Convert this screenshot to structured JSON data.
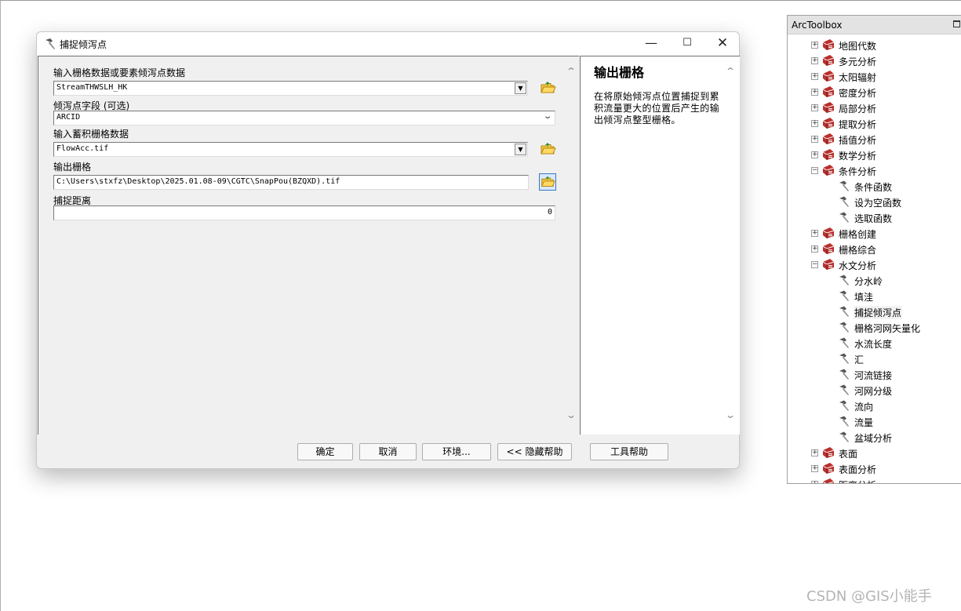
{
  "dialog": {
    "title": "捕捉倾泻点",
    "params": {
      "input_raster_label": "输入栅格数据或要素倾泻点数据",
      "input_raster_value": "StreamTHWSLH_HK",
      "pour_field_label": "倾泻点字段 (可选)",
      "pour_field_value": "ARCID",
      "accum_label": "输入蓄积栅格数据",
      "accum_value": "FlowAcc.tif",
      "output_label": "输出栅格",
      "output_value": "C:\\Users\\stxfz\\Desktop\\2025.01.08-09\\CGTC\\SnapPou(BZQXD).tif",
      "snap_label": "捕捉距离",
      "snap_value": "0"
    },
    "help": {
      "title": "输出栅格",
      "text": "在将原始倾泻点位置捕捉到累积流量更大的位置后产生的输出倾泻点整型栅格。"
    },
    "buttons": {
      "ok": "确定",
      "cancel": "取消",
      "env": "环境...",
      "hide_help": "<< 隐藏帮助",
      "tool_help": "工具帮助"
    }
  },
  "toolbox": {
    "title": "ArcToolbox",
    "items": [
      {
        "label": "地图代数",
        "type": "toolset",
        "expanded": false
      },
      {
        "label": "多元分析",
        "type": "toolset",
        "expanded": false
      },
      {
        "label": "太阳辐射",
        "type": "toolset",
        "expanded": false
      },
      {
        "label": "密度分析",
        "type": "toolset",
        "expanded": false
      },
      {
        "label": "局部分析",
        "type": "toolset",
        "expanded": false
      },
      {
        "label": "提取分析",
        "type": "toolset",
        "expanded": false
      },
      {
        "label": "插值分析",
        "type": "toolset",
        "expanded": false
      },
      {
        "label": "数学分析",
        "type": "toolset",
        "expanded": false
      },
      {
        "label": "条件分析",
        "type": "toolset",
        "expanded": true
      },
      {
        "label": "条件函数",
        "type": "tool"
      },
      {
        "label": "设为空函数",
        "type": "tool"
      },
      {
        "label": "选取函数",
        "type": "tool"
      },
      {
        "label": "栅格创建",
        "type": "toolset",
        "expanded": false
      },
      {
        "label": "栅格综合",
        "type": "toolset",
        "expanded": false
      },
      {
        "label": "水文分析",
        "type": "toolset",
        "expanded": true
      },
      {
        "label": "分水岭",
        "type": "tool"
      },
      {
        "label": "填洼",
        "type": "tool"
      },
      {
        "label": "捕捉倾泻点",
        "type": "tool",
        "selected": true
      },
      {
        "label": "栅格河网矢量化",
        "type": "tool"
      },
      {
        "label": "水流长度",
        "type": "tool"
      },
      {
        "label": "汇",
        "type": "tool"
      },
      {
        "label": "河流链接",
        "type": "tool"
      },
      {
        "label": "河网分级",
        "type": "tool"
      },
      {
        "label": "流向",
        "type": "tool"
      },
      {
        "label": "流量",
        "type": "tool"
      },
      {
        "label": "盆域分析",
        "type": "tool"
      },
      {
        "label": "表面",
        "type": "toolset",
        "expanded": false
      },
      {
        "label": "表面分析",
        "type": "toolset",
        "expanded": false
      },
      {
        "label": "距离分析",
        "type": "toolset",
        "expanded": false
      }
    ]
  },
  "watermark": "CSDN @GIS小能手",
  "colors": {
    "dialog_bg": "#f0f0f0",
    "titlebar_bg": "#ffffff",
    "toolbox_header_bg": "#e3e3e3",
    "active_button_border": "#3a78c8",
    "toolset_icon_red": "#b9302d"
  }
}
